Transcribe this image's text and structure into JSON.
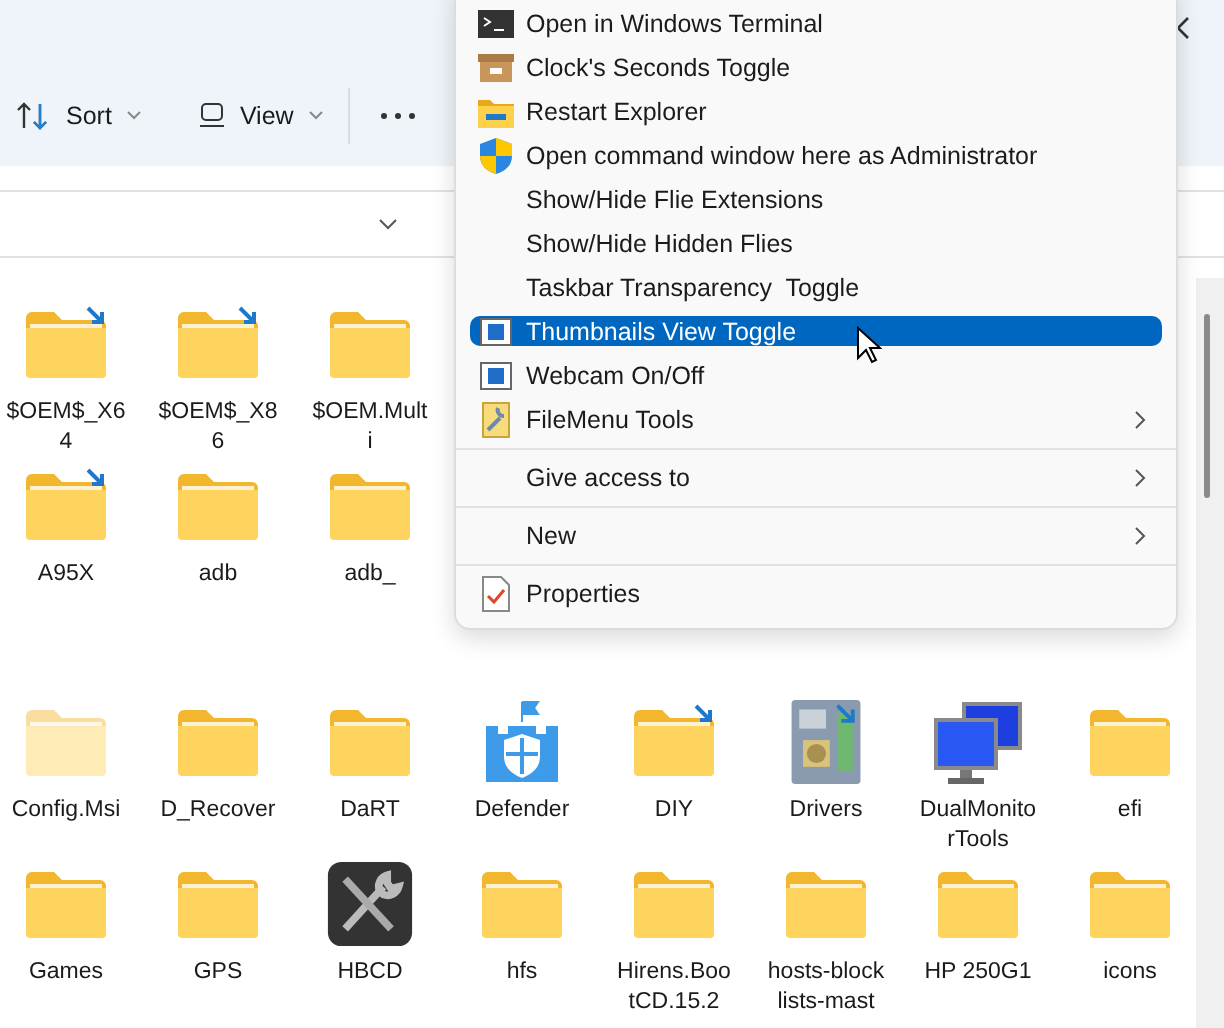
{
  "toolbar": {
    "sort": "Sort",
    "view": "View"
  },
  "files": [
    [
      {
        "name": "$OEM$_X64",
        "kind": "linked-folder"
      },
      {
        "name": "$OEM$_X86",
        "kind": "linked-folder"
      },
      {
        "name": "$OEM.Multi",
        "kind": "folder"
      }
    ],
    [
      {
        "name": "A95X",
        "kind": "linked-folder"
      },
      {
        "name": "adb",
        "kind": "folder"
      },
      {
        "name": "adb_",
        "kind": "folder"
      }
    ],
    [
      {
        "name": "Config.Msi",
        "kind": "hidden-folder"
      },
      {
        "name": "D_Recover",
        "kind": "folder"
      },
      {
        "name": "DaRT",
        "kind": "folder"
      },
      {
        "name": "Defender",
        "kind": "castle"
      },
      {
        "name": "DIY",
        "kind": "linked-folder"
      },
      {
        "name": "Drivers",
        "kind": "board"
      },
      {
        "name": "DualMonitorTools",
        "kind": "monitors"
      },
      {
        "name": "efi",
        "kind": "folder"
      }
    ],
    [
      {
        "name": "Games",
        "kind": "folder"
      },
      {
        "name": "GPS",
        "kind": "folder"
      },
      {
        "name": "HBCD",
        "kind": "tools"
      },
      {
        "name": "hfs",
        "kind": "folder"
      },
      {
        "name": "Hirens.BootCD.15.2",
        "kind": "folder"
      },
      {
        "name": "hosts-blocklists-mast",
        "kind": "folder"
      },
      {
        "name": "HP 250G1",
        "kind": "folder"
      },
      {
        "name": "icons",
        "kind": "folder"
      }
    ]
  ],
  "menu": [
    {
      "label": "Open in Windows Terminal",
      "kind": "terminal",
      "selected": false,
      "submenu": false,
      "separator_before": false
    },
    {
      "label": "Clock's Seconds Toggle",
      "kind": "box",
      "selected": false,
      "submenu": false,
      "separator_before": false
    },
    {
      "label": "Restart Explorer",
      "kind": "folder",
      "selected": false,
      "submenu": false,
      "separator_before": false
    },
    {
      "label": "Open command window here as Administrator",
      "kind": "shield",
      "selected": false,
      "submenu": false,
      "separator_before": false
    },
    {
      "label": "Show/Hide Flie Extensions",
      "kind": "plain",
      "selected": false,
      "submenu": false,
      "separator_before": false
    },
    {
      "label": "Show/Hide Hidden Flies",
      "kind": "plain",
      "selected": false,
      "submenu": false,
      "separator_before": false
    },
    {
      "label": "Taskbar Transparency  Toggle",
      "kind": "plain",
      "selected": false,
      "submenu": false,
      "separator_before": false
    },
    {
      "label": "Thumbnails View Toggle",
      "kind": "frame",
      "selected": true,
      "submenu": false,
      "separator_before": false
    },
    {
      "label": "Webcam On/Off",
      "kind": "frame",
      "selected": false,
      "submenu": false,
      "separator_before": false
    },
    {
      "label": "FileMenu Tools",
      "kind": "wrench",
      "selected": false,
      "submenu": true,
      "separator_before": false
    },
    {
      "label": "Give access to",
      "kind": "plain",
      "selected": false,
      "submenu": true,
      "separator_before": true
    },
    {
      "label": "New",
      "kind": "plain",
      "selected": false,
      "submenu": true,
      "separator_before": true
    },
    {
      "label": "Properties",
      "kind": "check",
      "selected": false,
      "submenu": false,
      "separator_before": true
    }
  ]
}
